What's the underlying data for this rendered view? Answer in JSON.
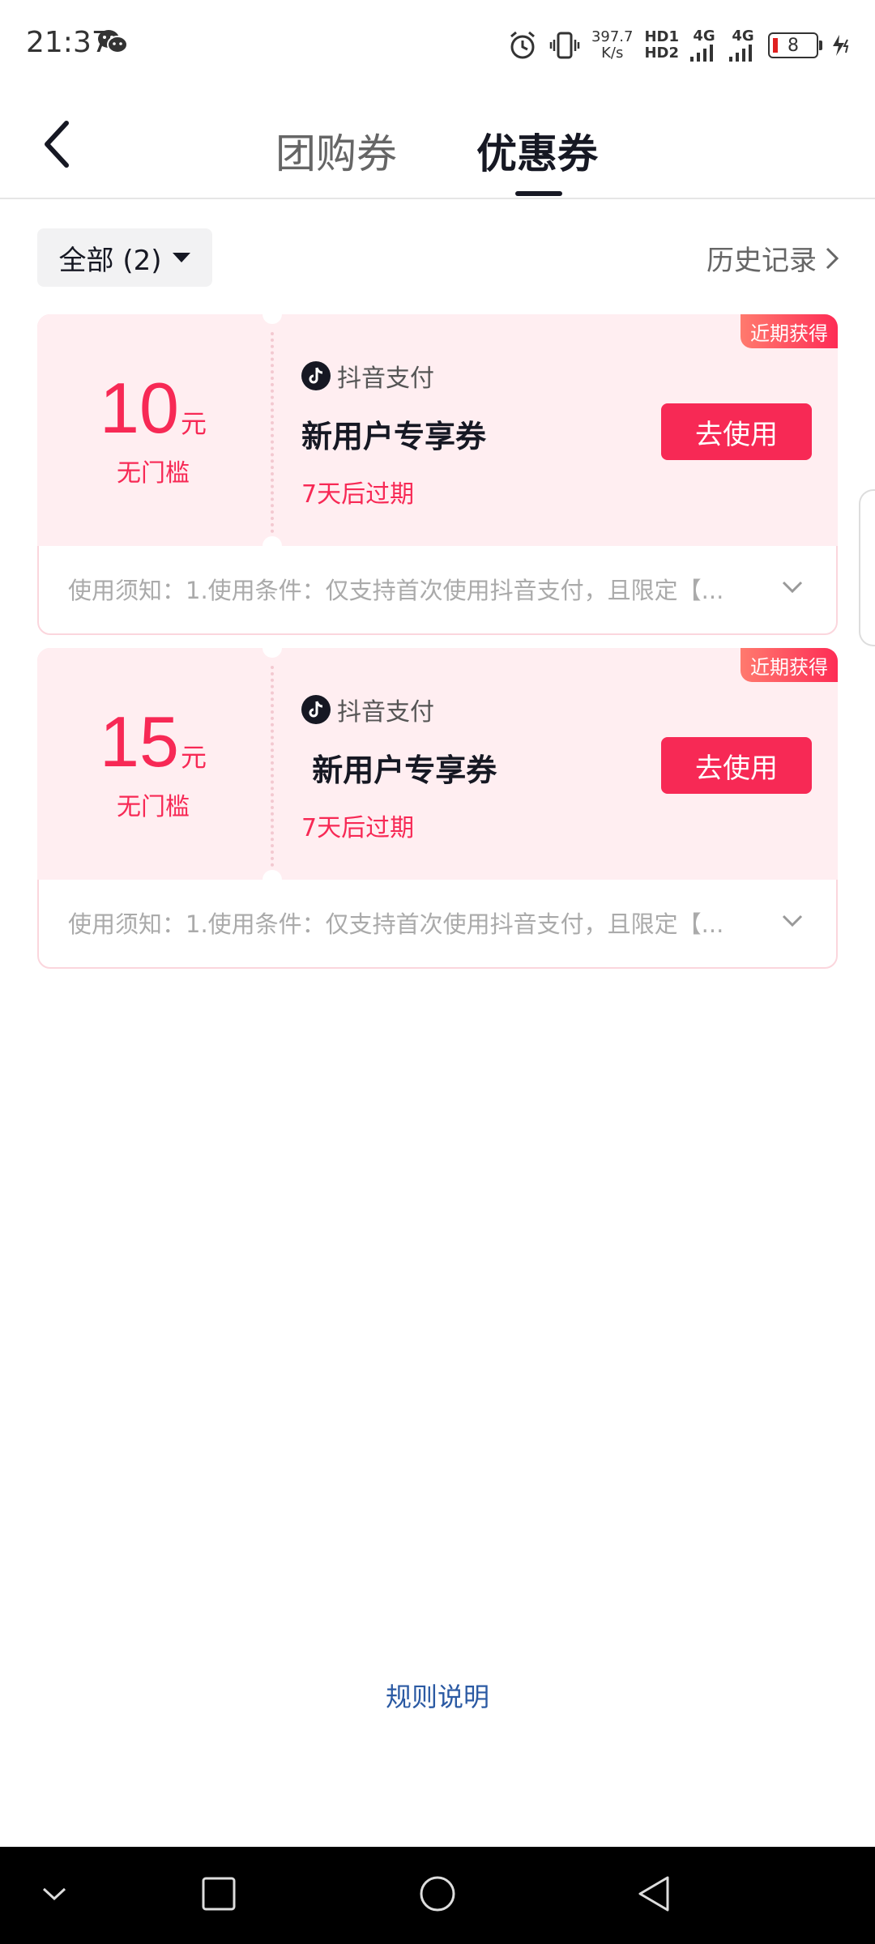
{
  "status_bar": {
    "time": "21:37",
    "net_speed_value": "397.7",
    "net_speed_unit": "K/s",
    "hd1": "HD1",
    "hd2": "HD2",
    "signal1": "4G",
    "signal2": "4G",
    "battery": "8"
  },
  "header": {
    "tabs": [
      {
        "label": "团购券",
        "active": false
      },
      {
        "label": "优惠券",
        "active": true
      }
    ]
  },
  "filter": {
    "label": "全部 (2)",
    "history_label": "历史记录"
  },
  "coupons": [
    {
      "amount": "10",
      "unit": "元",
      "threshold": "无门槛",
      "brand": "抖音支付",
      "title": "新用户专享券",
      "expiry": "7天后过期",
      "button": "去使用",
      "badge": "近期获得",
      "notice": "使用须知：1.使用条件：仅支持首次使用抖音支付，且限定【..."
    },
    {
      "amount": "15",
      "unit": "元",
      "threshold": "无门槛",
      "brand": "抖音支付",
      "title": " 新用户专享券",
      "expiry": "7天后过期",
      "button": "去使用",
      "badge": "近期获得",
      "notice": "使用须知：1.使用条件：仅支持首次使用抖音支付，且限定【..."
    }
  ],
  "footer": {
    "rules_label": "规则说明"
  },
  "colors": {
    "accent": "#f72955",
    "card_bg": "#ffeef1",
    "link": "#2b5aa3"
  }
}
